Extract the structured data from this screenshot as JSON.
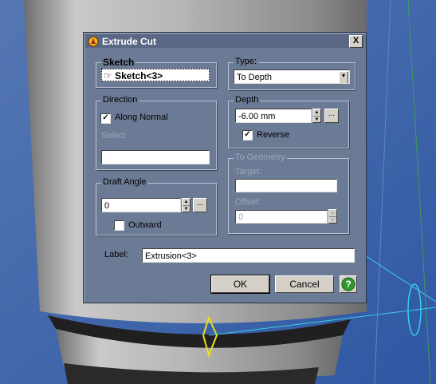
{
  "dialog": {
    "title": "Extrude Cut",
    "close_glyph": "X",
    "sketch": {
      "title": "Sketch",
      "value": "Sketch<3>"
    },
    "type": {
      "title": "Type:",
      "selected": "To Depth"
    },
    "direction": {
      "title": "Direction",
      "along_normal_label": "Along Normal",
      "along_normal_checked": true,
      "select_label": "Select",
      "select_value": ""
    },
    "depth": {
      "title": "Depth",
      "value": "-6.00 mm",
      "reverse_label": "Reverse",
      "reverse_checked": true,
      "ellipsis": "..."
    },
    "to_geometry": {
      "title": "To Geometry",
      "target_label": "Target:",
      "target_value": "",
      "offset_label": "Offset:",
      "offset_value": "0"
    },
    "draft_angle": {
      "title": "Draft Angle",
      "value": "0",
      "outward_label": "Outward",
      "outward_checked": false,
      "ellipsis": "..."
    },
    "label": {
      "title": "Label:",
      "value": "Extrusion<3>"
    },
    "buttons": {
      "ok": "OK",
      "cancel": "Cancel",
      "help": "?"
    }
  },
  "colors": {
    "dialog_bg": "#6c7b95",
    "viewport_bg": "#4b6fa8",
    "model_gray": "#a8a8a8",
    "help_green": "#2e9a2e",
    "axis_cyan": "#36d0e8",
    "highlight_yellow": "#e8e020"
  }
}
